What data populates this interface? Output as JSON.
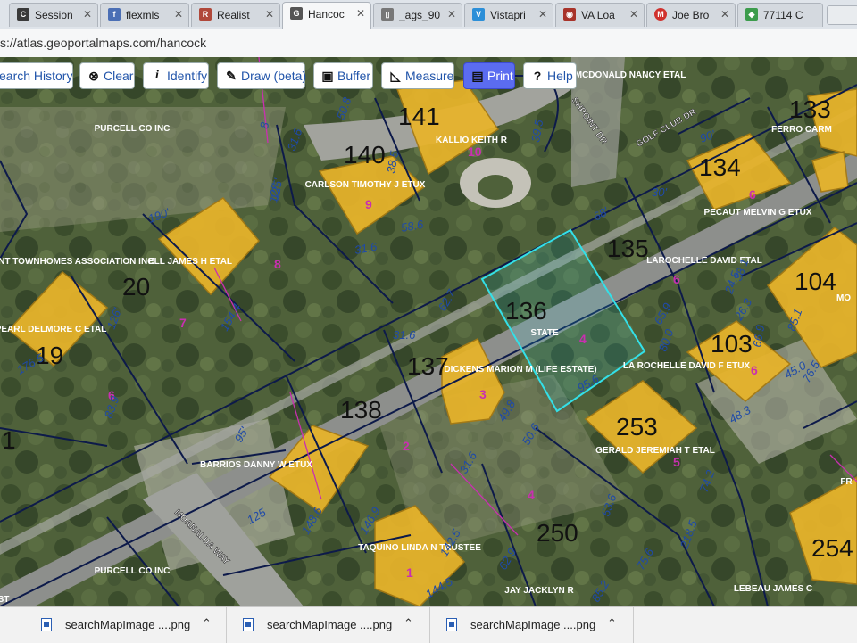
{
  "browser": {
    "tabs": [
      {
        "label": "Session",
        "icon": "c-logo-icon",
        "color": "#3a3a3a",
        "glyph": "C"
      },
      {
        "label": "flexmls",
        "icon": "flexmls-icon",
        "color": "#4b6fb5",
        "glyph": "f"
      },
      {
        "label": "Realist",
        "icon": "realist-icon",
        "color": "#b0483a",
        "glyph": "R"
      },
      {
        "label": "Hancoc",
        "icon": "geoportal-icon",
        "color": "#555555",
        "glyph": "G",
        "active": true
      },
      {
        "label": "_ags_90",
        "icon": "document-icon",
        "color": "#777777",
        "glyph": "▯"
      },
      {
        "label": "Vistapri",
        "icon": "vistaprint-icon",
        "color": "#2c8fd8",
        "glyph": "V"
      },
      {
        "label": "VA Loa",
        "icon": "va-seal-icon",
        "color": "#a8332a",
        "glyph": "◉"
      },
      {
        "label": "Joe Bro",
        "icon": "mm-icon",
        "color": "#d0312d",
        "glyph": "M"
      },
      {
        "label": "77114 C",
        "icon": "maps-pin-icon",
        "color": "#3c9c4c",
        "glyph": "◆"
      }
    ],
    "url": "s://atlas.geoportalmaps.com/hancock"
  },
  "toolbar": {
    "buttons": [
      {
        "label": "earch History",
        "icon": ""
      },
      {
        "label": "Clear",
        "icon": "clear-icon",
        "glyph": "⊗"
      },
      {
        "label": "Identify",
        "icon": "info-icon",
        "glyph": "i"
      },
      {
        "label": "Draw (beta)",
        "icon": "pencil-icon",
        "glyph": "✎"
      },
      {
        "label": "Buffer",
        "icon": "buffer-icon",
        "glyph": "▣"
      },
      {
        "label": "Measure",
        "icon": "ruler-icon",
        "glyph": "◺"
      },
      {
        "label": "Print",
        "icon": "printer-icon",
        "glyph": "▤",
        "active": true
      },
      {
        "label": "Help",
        "icon": "help-icon",
        "glyph": "?"
      }
    ]
  },
  "map": {
    "colors": {
      "building": "#e8b42a",
      "parcel_line": "#0d1a4a",
      "selected": "#33e0e8",
      "road": "#8d8f8c",
      "owner_text": "#ffffff",
      "lot_text": "#c92fb0",
      "dim_text": "#1f4aa8"
    },
    "parcel_numbers": [
      "141",
      "140",
      "135",
      "133",
      "134",
      "136",
      "20",
      "19",
      "137",
      "138",
      "103",
      "104",
      "253",
      "250",
      "254",
      "1"
    ],
    "owners": [
      "PURCELL CO INC",
      "KALLIO KEITH R",
      "MCDONALD NANCY ETAL",
      "FERRO CARM",
      "CARLSON TIMOTHY J ETUX",
      "PECAUT MELVIN G ETUX",
      "OINT TOWNHOMES ASSOCIATION INC",
      "ELL JAMES H ETAL",
      "LAROCHELLE DAVID ETAL",
      "MO",
      "PEARL DELMORE C ETAL",
      "STATE",
      "DICKENS MARION M (LIFE ESTATE)",
      "LA ROCHELLE DAVID F ETUX",
      "GERALD JEREMIAH T ETAL",
      "BARRIOS DANNY W ETUX",
      "TAQUINO LINDA N TRUSTEE",
      "PURCELL CO INC",
      "JAY JACKLYN R",
      "LEBEAU JAMES C",
      "FR",
      "ST"
    ],
    "lot_numbers": [
      "10",
      "9",
      "8",
      "7",
      "6",
      "6",
      "4",
      "3",
      "2",
      "4",
      "1",
      "5",
      "6",
      "6"
    ],
    "dimensions": [
      "50.8",
      "31.6",
      "125",
      "38.5",
      "39.5",
      "30'",
      "90'",
      "190'",
      "31.6",
      "58.6",
      "125'",
      "154.4",
      "8'",
      "126'",
      "68'",
      "62.7",
      "31.6",
      "65.9",
      "80.0",
      "26.3",
      "66.9",
      "85.1",
      "176.5",
      "83.9",
      "95.6",
      "48.3",
      "45.0",
      "76.5",
      "95'",
      "49.8",
      "50.6",
      "31.6",
      "125",
      "142.5",
      "146.9",
      "148.6",
      "218.5",
      "74.2",
      "75.6",
      "85.2",
      "144.5",
      "62.9",
      "53.6",
      "38.1",
      "24.5"
    ],
    "street_labels": [
      "GOLF CLUB DR",
      "SHPOINT DR",
      "MOANALUA WAY"
    ]
  },
  "downloads": [
    {
      "label": "searchMapImage ....png",
      "icon": "image-file-icon"
    },
    {
      "label": "searchMapImage ....png",
      "icon": "image-file-icon"
    },
    {
      "label": "searchMapImage ....png",
      "icon": "image-file-icon"
    }
  ]
}
